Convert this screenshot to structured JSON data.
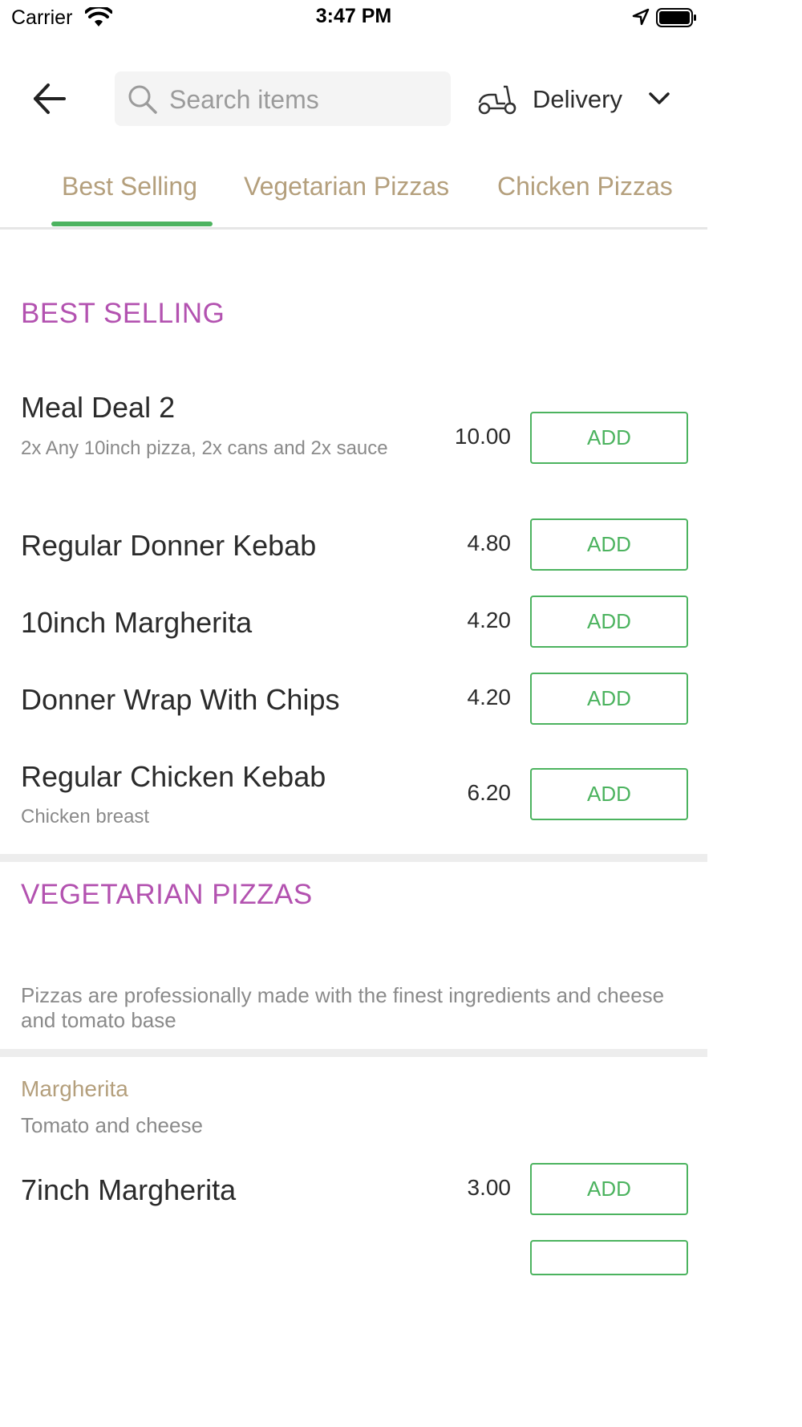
{
  "status_bar": {
    "carrier": "Carrier",
    "time": "3:47 PM"
  },
  "header": {
    "search_placeholder": "Search items",
    "delivery_label": "Delivery"
  },
  "tabs": [
    {
      "label": "Best Selling",
      "active": true
    },
    {
      "label": "Vegetarian Pizzas",
      "active": false
    },
    {
      "label": "Chicken Pizzas",
      "active": false
    }
  ],
  "best_selling": {
    "title": "BEST SELLING",
    "items": [
      {
        "name": "Meal Deal 2",
        "description": "2x Any 10inch pizza, 2x cans and 2x sauce",
        "price": "10.00",
        "action": "ADD"
      },
      {
        "name": "Regular Donner Kebab",
        "description": "",
        "price": "4.80",
        "action": "ADD"
      },
      {
        "name": "10inch Margherita",
        "description": "",
        "price": "4.20",
        "action": "ADD"
      },
      {
        "name": "Donner Wrap With Chips",
        "description": "",
        "price": "4.20",
        "action": "ADD"
      },
      {
        "name": "Regular Chicken Kebab",
        "description": "Chicken breast",
        "price": "6.20",
        "action": "ADD"
      }
    ]
  },
  "vegetarian": {
    "title": "VEGETARIAN PIZZAS",
    "description": "Pizzas are professionally made with the finest ingredients and cheese and tomato base",
    "subsection": {
      "title": "Margherita",
      "description": "Tomato and cheese"
    },
    "items": [
      {
        "name": "7inch Margherita",
        "price": "3.00",
        "action": "ADD"
      }
    ]
  },
  "colors": {
    "accent_green": "#4cb35f",
    "section_purple": "#b352b0",
    "tab_tan": "#b49f7c"
  }
}
